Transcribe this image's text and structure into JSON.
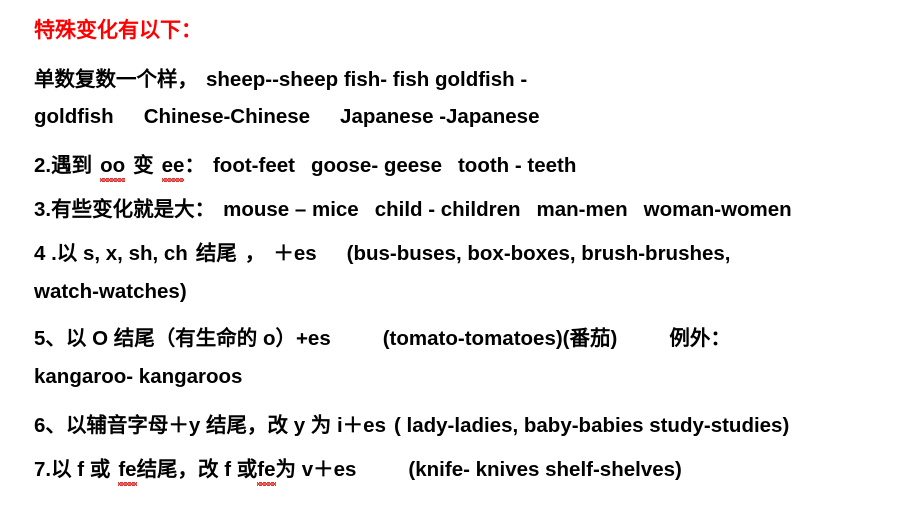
{
  "document": {
    "type": "lesson-slide",
    "topic": "english-irregular-plural-nouns",
    "background_color": "#ffffff",
    "heading_color": "#ff0000",
    "body_color": "#000000",
    "spellcheck_underline_color": "#e03030"
  },
  "heading": {
    "text": "特殊变化有以下："
  },
  "rules": {
    "rule1": {
      "line1_label": "单数复数一个样，",
      "line1_examples": "sheep--sheep fish- fish   goldfish -",
      "line2_examples_a": "goldfish",
      "line2_examples_b": "Chinese-Chinese",
      "line2_examples_c": "Japanese -Japanese"
    },
    "rule2": {
      "number": "2.",
      "text_a": "遇到",
      "token_oo": "oo",
      "text_b": "变",
      "token_ee": "ee",
      "colon": "：",
      "example1": "foot-feet",
      "example2": "goose- geese",
      "example3": "tooth - teeth"
    },
    "rule3": {
      "number": "3.",
      "text": "有些变化就是大：",
      "example1": "mouse – mice",
      "example2": "child - children",
      "example3": "man-men",
      "example4": "woman-women"
    },
    "rule4": {
      "number": "4 .",
      "text_a": "以 s, x, sh, ch",
      "text_b": "结尾",
      "comma": "，",
      "suffix": "＋es",
      "examples_line1": "(bus-buses, box-boxes,  brush-brushes,",
      "examples_line2": "watch-watches)"
    },
    "rule5": {
      "number": "5、",
      "text": "以 O  结尾（有生命的 o）+es",
      "example": "(tomato-tomatoes)(番茄)",
      "exception_label": "例外：",
      "exception_example": "kangaroo- kangaroos"
    },
    "rule6": {
      "number": "6、",
      "text": "以辅音字母＋y 结尾，改 y 为 i＋es",
      "examples": "( lady-ladies,  baby-babies  study-studies)"
    },
    "rule7": {
      "number": "7.",
      "text_a": "以 f  或",
      "token_fe1": "fe",
      "text_b": "结尾，改 f 或",
      "token_fe2": "fe",
      "text_c": "为 v＋es",
      "examples": "(knife- knives    shelf-shelves)"
    }
  }
}
